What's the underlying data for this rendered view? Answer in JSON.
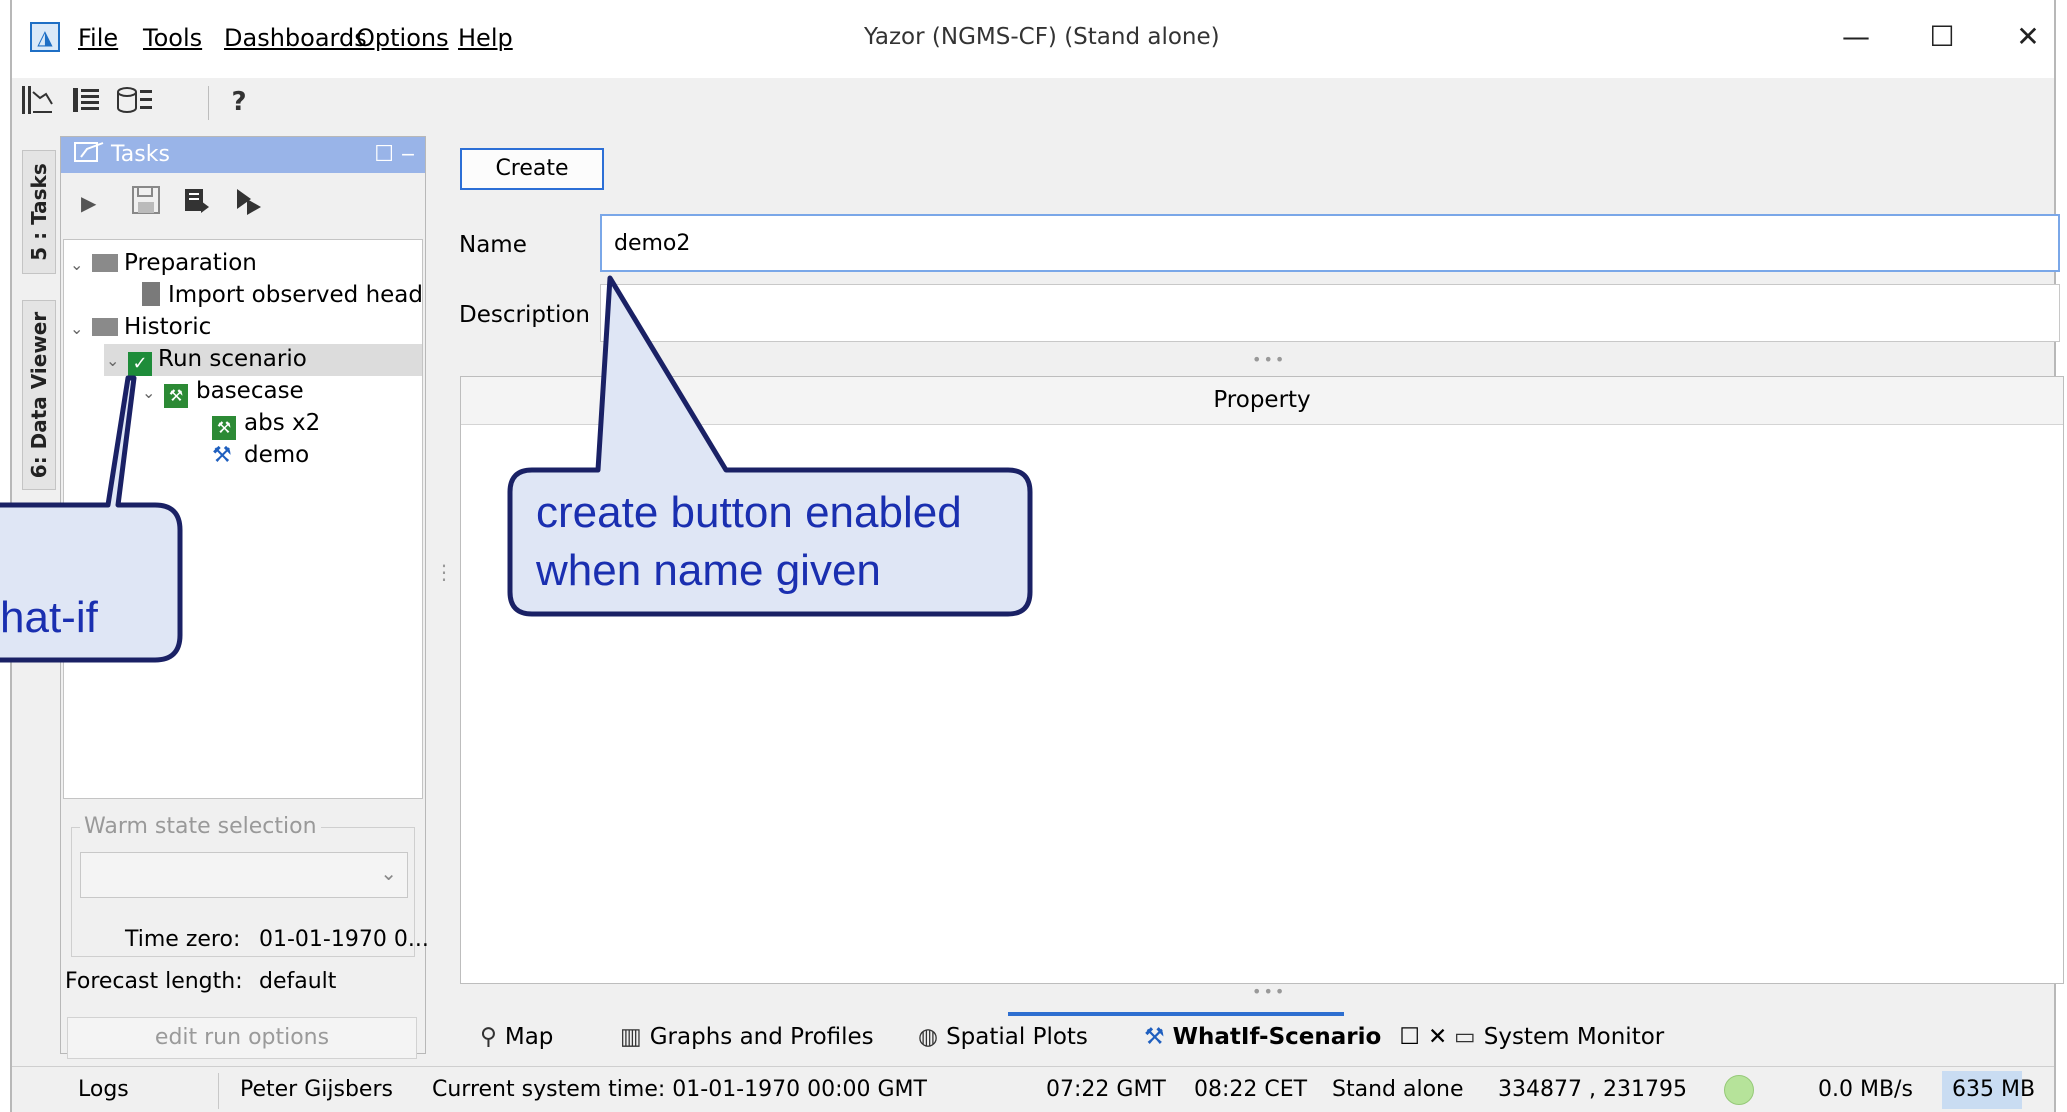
{
  "app": {
    "title": "Yazor (NGMS-CF)  (Stand alone)",
    "icon_name": "app-logo-icon"
  },
  "menu": {
    "items": [
      {
        "label": "File"
      },
      {
        "label": "Tools"
      },
      {
        "label": "Dashboards"
      },
      {
        "label": "Options"
      },
      {
        "label": "Help"
      }
    ]
  },
  "window_controls": {
    "minimize": "—",
    "maximize": "☐",
    "close": "✕"
  },
  "toolbar": {
    "help_label": "?",
    "icons": [
      "graphs-icon",
      "table-icon",
      "database-icon"
    ]
  },
  "side_tabs": {
    "tasks": "5 : Tasks",
    "data_viewer": "6: Data Viewer"
  },
  "tasks_panel": {
    "title": "Tasks",
    "tree": [
      {
        "label": "Preparation",
        "type": "folder"
      },
      {
        "label": "Import observed heads",
        "type": "file"
      },
      {
        "label": "Historic",
        "type": "folder"
      },
      {
        "label": "Run scenario",
        "type": "check",
        "selected": true
      },
      {
        "label": "basecase",
        "type": "scenario"
      },
      {
        "label": "abs x2",
        "type": "scenario"
      },
      {
        "label": "demo",
        "type": "tool"
      }
    ],
    "warm_state_label": "Warm state selection",
    "warm_state_value": "",
    "time_zero_label": "Time zero:",
    "time_zero_value": "01-01-1970 0...",
    "forecast_length_label": "Forecast length:",
    "forecast_length_value": "default",
    "edit_run_options": "edit run options"
  },
  "main": {
    "create_button": "Create",
    "name_label": "Name",
    "name_value": "demo2",
    "description_label": "Description",
    "description_value": "",
    "property_header": "Property"
  },
  "bottom_tabs": [
    {
      "label": "Map",
      "icon": "map-icon"
    },
    {
      "label": "Graphs and Profiles",
      "icon": "graphs-icon"
    },
    {
      "label": "Spatial Plots",
      "icon": "globe-icon"
    },
    {
      "label": "WhatIf-Scenario",
      "icon": "tools-icon",
      "active": true
    },
    {
      "label": "System Monitor",
      "icon": "monitor-icon"
    }
  ],
  "statusbar": {
    "logs": "Logs",
    "user": "Peter Gijsbers",
    "system_time": "Current system time: 01-01-1970 00:00 GMT",
    "gmt_time": "07:22 GMT",
    "cet_time": "08:22 CET",
    "mode": "Stand alone",
    "coords": "334877 , 231795",
    "rate": "0.0 MB/s",
    "memory": "635 MB"
  },
  "callouts": {
    "left_text": "hat-if",
    "right_line1": "create button enabled",
    "right_line2": "when name given"
  },
  "colors": {
    "accent": "#2c6fd6",
    "callout_border": "#1a2165",
    "callout_fill": "#dfe6f5",
    "callout_text": "#1a2fb0",
    "tasks_header": "#99b4e8"
  }
}
